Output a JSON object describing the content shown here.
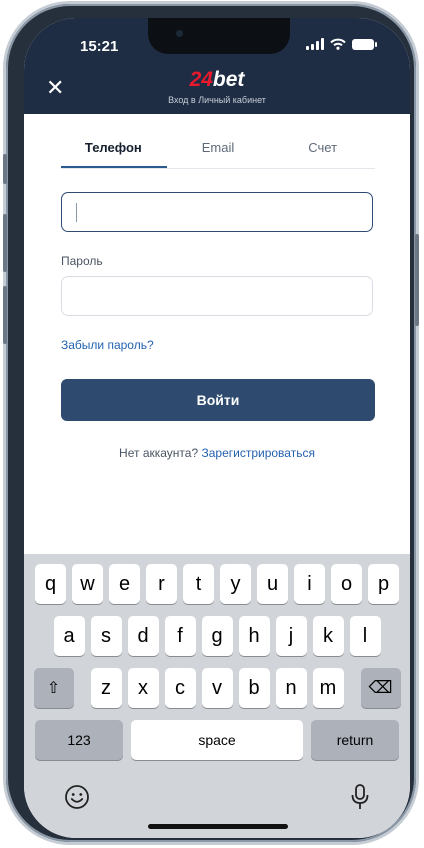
{
  "status_bar": {
    "time": "15:21"
  },
  "header": {
    "logo_number": "24",
    "logo_word": "bet",
    "subtitle": "Вход в Личный кабинет",
    "close_icon": "close-icon"
  },
  "tabs": [
    {
      "label": "Телефон",
      "active": true
    },
    {
      "label": "Email",
      "active": false
    },
    {
      "label": "Счет",
      "active": false
    }
  ],
  "form": {
    "phone_value": "",
    "password_label": "Пароль",
    "password_value": "",
    "forgot_link": "Забыли пароль?",
    "login_button": "Войти",
    "no_account_text": "Нет аккаунта?",
    "register_link": "Зарегистрироваться"
  },
  "keyboard": {
    "row1": [
      "q",
      "w",
      "e",
      "r",
      "t",
      "y",
      "u",
      "i",
      "o",
      "p"
    ],
    "row2": [
      "a",
      "s",
      "d",
      "f",
      "g",
      "h",
      "j",
      "k",
      "l"
    ],
    "row3": [
      "z",
      "x",
      "c",
      "v",
      "b",
      "n",
      "m"
    ],
    "shift": "⇧",
    "backspace": "⌫",
    "numbers_key": "123",
    "space_key": "space",
    "return_key": "return",
    "emoji_icon": "emoji-icon",
    "mic_icon": "microphone-icon"
  }
}
